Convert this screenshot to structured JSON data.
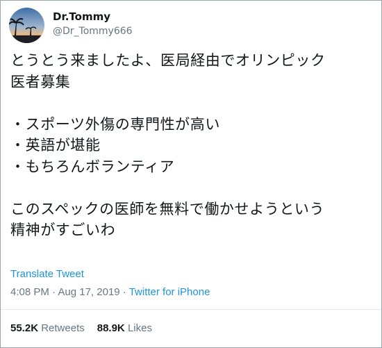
{
  "user": {
    "display_name": "Dr.Tommy",
    "handle": "@Dr_Tommy666",
    "avatar_icon": "sunset-palm-avatar"
  },
  "tweet": {
    "lines": [
      "とうとう来ましたよ、医局経由でオリンピック",
      "医者募集",
      "",
      "・スポーツ外傷の専門性が高い",
      "・英語が堪能",
      "・もちろんボランティア",
      "",
      "このスペックの医師を無料で働かせようという",
      "精神がすごいわ"
    ]
  },
  "translate_label": "Translate Tweet",
  "meta": {
    "time": "4:08 PM",
    "separator": " · ",
    "date": "Aug 17, 2019",
    "source": "Twitter for iPhone"
  },
  "stats": {
    "retweets_count": "55.2K",
    "retweets_label": "Retweets",
    "likes_count": "88.9K",
    "likes_label": "Likes"
  },
  "colors": {
    "link": "#1b95e0",
    "secondary": "#657786",
    "text": "#14171a"
  }
}
